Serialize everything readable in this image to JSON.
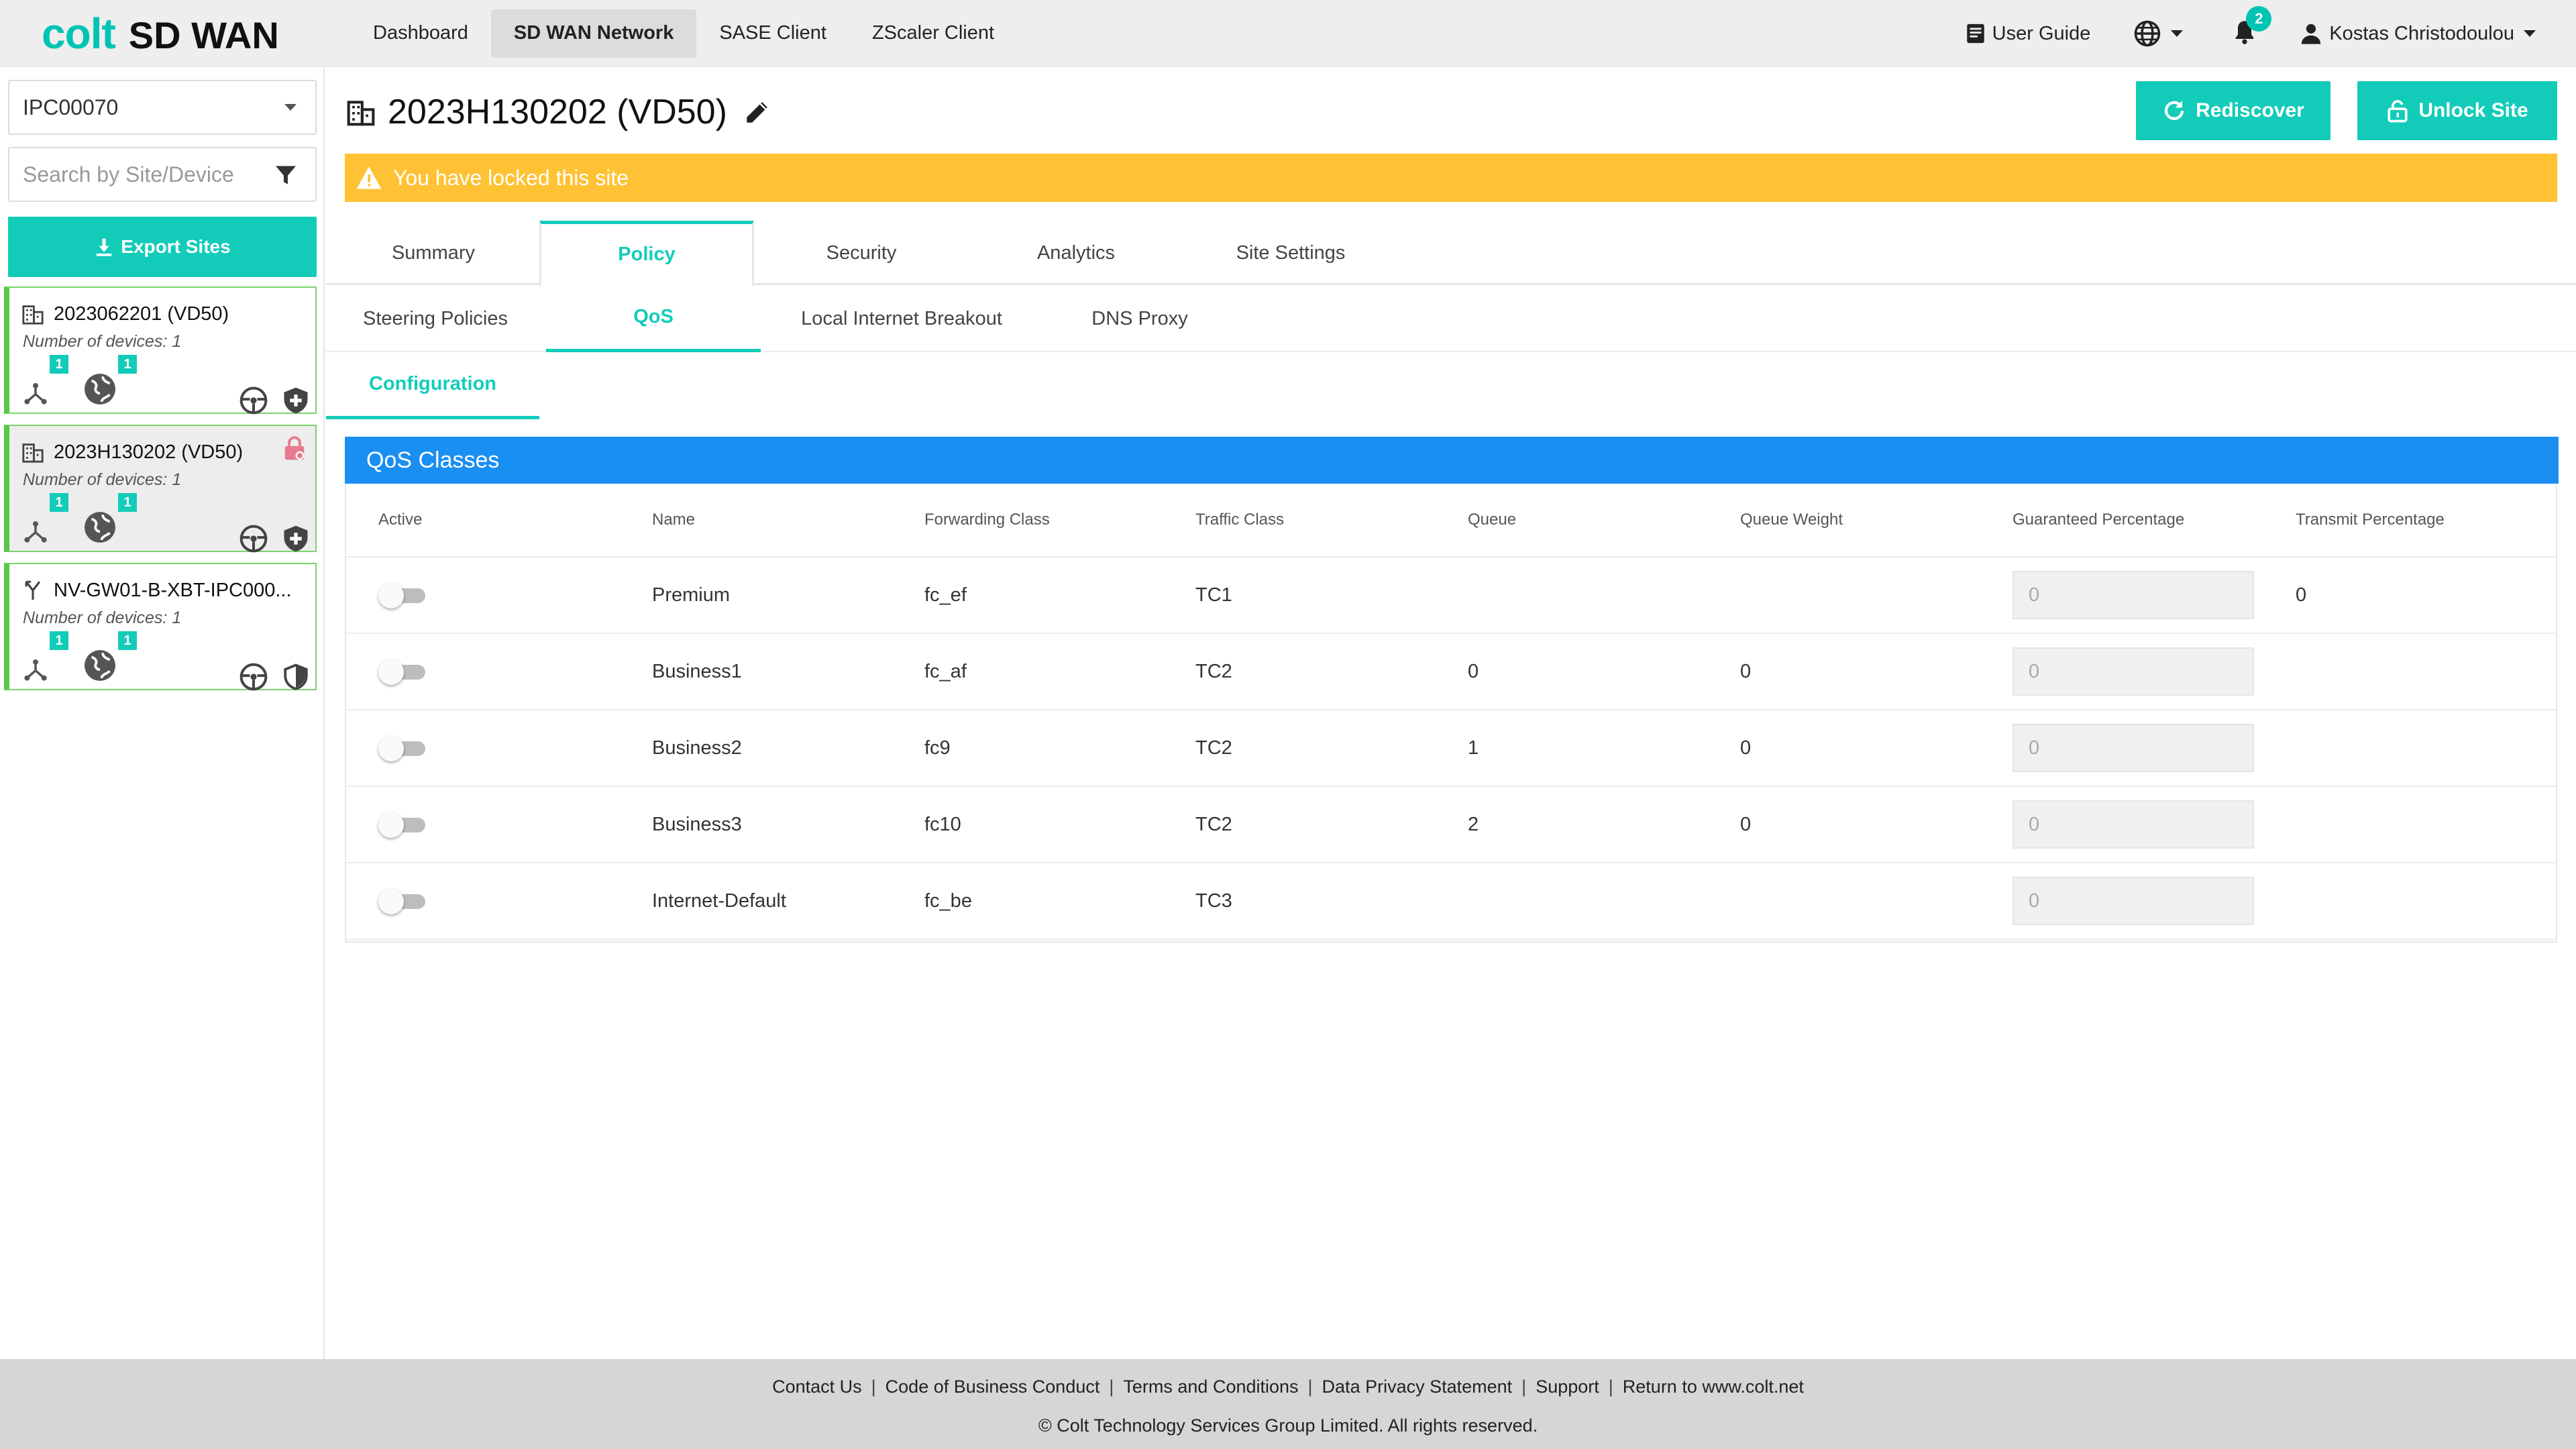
{
  "brand": {
    "logo_main": "colt",
    "logo_product": "SD WAN"
  },
  "nav": {
    "items": [
      {
        "label": "Dashboard"
      },
      {
        "label": "SD WAN Network"
      },
      {
        "label": "SASE Client"
      },
      {
        "label": "ZScaler Client"
      }
    ],
    "active_index": 1
  },
  "topbar": {
    "user_guide": "User Guide",
    "notifications_count": "2",
    "user_name": "Kostas Christodoulou"
  },
  "sidebar": {
    "tenant_value": "IPC00070",
    "search_placeholder": "Search by Site/Device",
    "export_label": "Export Sites",
    "sites": [
      {
        "name": "2023062201 (VD50)",
        "devices": "Number of devices: 1",
        "badge1": "1",
        "badge2": "1",
        "selected": false,
        "locked": false
      },
      {
        "name": "2023H130202 (VD50)",
        "devices": "Number of devices: 1",
        "badge1": "1",
        "badge2": "1",
        "selected": true,
        "locked": true
      },
      {
        "name": "NV-GW01-B-XBT-IPC000...",
        "devices": "Number of devices: 1",
        "badge1": "1",
        "badge2": "1",
        "selected": false,
        "locked": false
      }
    ]
  },
  "page": {
    "title": "2023H130202 (VD50)",
    "rediscover_label": "Rediscover",
    "unlock_label": "Unlock Site",
    "alert_text": "You have locked this site"
  },
  "tabs": {
    "primary": [
      "Summary",
      "Policy",
      "Security",
      "Analytics",
      "Site Settings"
    ],
    "primary_active": "Policy",
    "secondary": [
      "Steering Policies",
      "QoS",
      "Local Internet Breakout",
      "DNS Proxy"
    ],
    "secondary_active": "QoS",
    "tertiary": [
      "Configuration"
    ]
  },
  "qos": {
    "title": "QoS Classes",
    "columns": [
      "Active",
      "Name",
      "Forwarding Class",
      "Traffic Class",
      "Queue",
      "Queue Weight",
      "Guaranteed Percentage",
      "Transmit Percentage"
    ],
    "rows": [
      {
        "active": false,
        "name": "Premium",
        "forwarding_class": "fc_ef",
        "traffic_class": "TC1",
        "queue": "",
        "queue_weight": "",
        "guaranteed_placeholder": "0",
        "transmit": "0"
      },
      {
        "active": false,
        "name": "Business1",
        "forwarding_class": "fc_af",
        "traffic_class": "TC2",
        "queue": "0",
        "queue_weight": "0",
        "guaranteed_placeholder": "0",
        "transmit": ""
      },
      {
        "active": false,
        "name": "Business2",
        "forwarding_class": "fc9",
        "traffic_class": "TC2",
        "queue": "1",
        "queue_weight": "0",
        "guaranteed_placeholder": "0",
        "transmit": ""
      },
      {
        "active": false,
        "name": "Business3",
        "forwarding_class": "fc10",
        "traffic_class": "TC2",
        "queue": "2",
        "queue_weight": "0",
        "guaranteed_placeholder": "0",
        "transmit": ""
      },
      {
        "active": false,
        "name": "Internet-Default",
        "forwarding_class": "fc_be",
        "traffic_class": "TC3",
        "queue": "",
        "queue_weight": "",
        "guaranteed_placeholder": "0",
        "transmit": ""
      }
    ]
  },
  "footer": {
    "links": [
      "Contact Us",
      "Code of Business Conduct",
      "Terms and Conditions",
      "Data Privacy Statement",
      "Support",
      "Return to www.colt.net"
    ],
    "copyright": "© Colt Technology Services Group Limited. All rights reserved."
  },
  "colors": {
    "accent": "#12ccb9",
    "header_blue": "#1a8ff2",
    "alert_yellow": "#ffc234",
    "site_border_green": "#55c844",
    "lock_pink": "#e87a8e"
  },
  "icons": {
    "user_guide": "book-icon",
    "language": "globe-icon",
    "notifications": "bell-icon",
    "user": "person-icon",
    "filter": "filter-icon",
    "export": "download-icon",
    "site": "building-icon",
    "topology": "network-branch-icon",
    "internet": "globe-icon",
    "steering": "steering-wheel-icon",
    "security": "shield-icon",
    "edit": "pencil-icon",
    "rediscover": "refresh-icon",
    "unlock": "unlock-icon",
    "alert": "warning-icon"
  }
}
